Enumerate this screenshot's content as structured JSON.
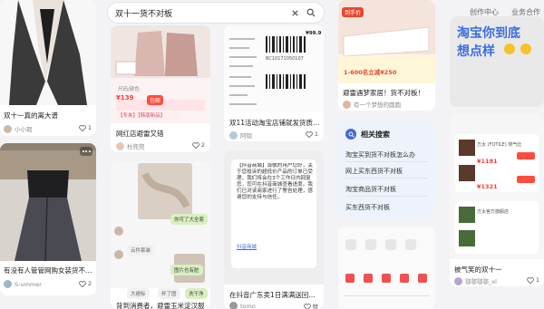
{
  "search": {
    "query": "双十一货不对板"
  },
  "topnav": {
    "creator": "创作中心",
    "business": "业务合作"
  },
  "col1": {
    "card1": {
      "title": "双十一真的离大谱",
      "author": "小小瑕",
      "likes": "1"
    },
    "card2": {
      "title": "有没有人管管网购女装货不对板",
      "author": "S-ummer",
      "likes": "2"
    }
  },
  "col2": {
    "card1": {
      "title": "网红店避雷又错",
      "author": "杜兜兜",
      "likes": "2",
      "price": "¥139",
      "badge": "包邮",
      "shop_line": "【冬夹】【韩版新品】",
      "size_note": "尺码/颜色"
    },
    "card2": {
      "title": "背到消费者，避雷玉米淀汉服",
      "author": "木木",
      "likes": "",
      "bubble1": "你可了大全套",
      "bubble2": "云件套装",
      "bubble3": "图片也有脏",
      "bubble4": "大裙标",
      "bubble5": "杯了图",
      "bubble6": "洗干净"
    }
  },
  "col3": {
    "card1": {
      "title": "双11活动淘宝店铺就发货质产品",
      "author": "阿瑕",
      "likes": "1",
      "price_tag": "¥99.9",
      "barcode_text": "BC10171050107"
    },
    "card2": {
      "title": "在抖音广东卖1日满满送回买的sk2",
      "author": "tomo",
      "likes": "赞",
      "chat_text": "【抖音商城】尊敬的用户您好，关于您投诉的超低价产品的订单已受理，我们将会在3个工作日内回复您，您可在抖音商城查看进度。我们已对该商家进行了警告处理，感谢您的支持与信任。",
      "link_text": "抖音商城"
    }
  },
  "col4": {
    "card1": {
      "title": "避雷遇梦家居！货不对板！",
      "author": "有一个梦想的圆圆",
      "likes": "",
      "banner": "1-600名立减¥250",
      "tag": "到手价"
    },
    "related": {
      "header": "相关搜索",
      "items": [
        "淘宝买到货不对板怎么办",
        "网上买东西货不对板",
        "淘宝商品货不对板",
        "买东西货不对板"
      ]
    },
    "card3": {
      "title": "",
      "author": "",
      "likes": ""
    }
  },
  "col5": {
    "card1": {
      "title_line1": "淘宝你到底",
      "title_line2": "想点样",
      "author": "",
      "likes": ""
    },
    "card2": {
      "title": "被气笑的双十一",
      "author": "鄂鄂鄂鄂_xl",
      "likes": "1",
      "price1": "¥1181",
      "price2": "¥1321",
      "item_text": "方太 (FOTILE) 燃气灶",
      "shop": "方太官方旗舰店"
    }
  },
  "colors": {
    "accent": "#ff2442",
    "related_bg": "#eef2fa",
    "related_icon": "#3f6ad8"
  },
  "icons": [
    "search-icon",
    "clear-icon",
    "heart-icon",
    "user-avatar",
    "more-icon",
    "search-circle-icon"
  ]
}
